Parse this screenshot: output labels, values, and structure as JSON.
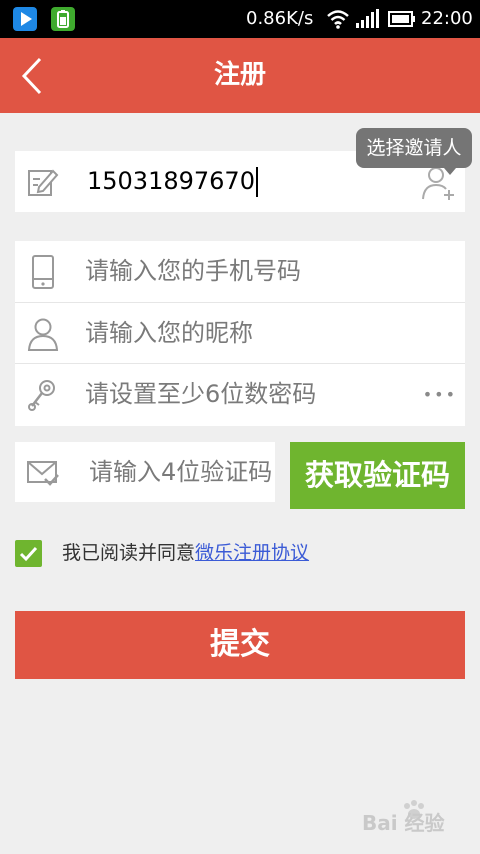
{
  "status_bar": {
    "speed": "0.86K/s",
    "time": "22:00"
  },
  "header": {
    "title": "注册"
  },
  "inviter": {
    "value": "15031897670",
    "tooltip": "选择邀请人"
  },
  "form": {
    "phone_placeholder": "请输入您的手机号码",
    "nickname_placeholder": "请输入您的昵称",
    "password_placeholder": "请设置至少6位数密码",
    "password_toggle": "•••",
    "code_placeholder": "请输入4位验证码",
    "get_code_label": "获取验证码"
  },
  "agreement": {
    "checked": true,
    "text": "我已阅读并同意",
    "link": "微乐注册协议"
  },
  "submit_label": "提交",
  "watermark": "Bai 经验",
  "colors": {
    "accent": "#e05544",
    "green": "#6fb52f",
    "link": "#3b5bd6"
  }
}
